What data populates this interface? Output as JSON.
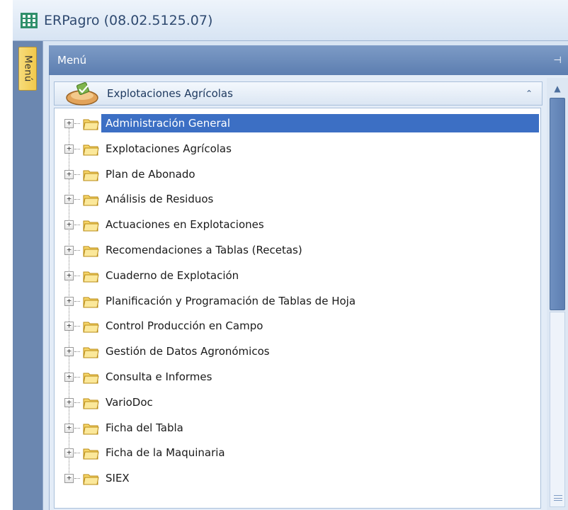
{
  "window": {
    "title": "ERPagro (08.02.5125.07)",
    "icon": "grid-app-icon"
  },
  "sidebar_tab": {
    "label": "Menú"
  },
  "panel": {
    "title": "Menú",
    "pin_icon": "pin-icon"
  },
  "group": {
    "title": "Explotaciones Agrícolas",
    "icon": "tractor-seed-icon",
    "collapse_icon": "double-chevron-up-icon"
  },
  "tree": {
    "selected_index": 0,
    "items": [
      {
        "label": "Administración General"
      },
      {
        "label": "Explotaciones Agrícolas"
      },
      {
        "label": "Plan de Abonado"
      },
      {
        "label": "Análisis de Residuos"
      },
      {
        "label": "Actuaciones en Explotaciones"
      },
      {
        "label": "Recomendaciones a Tablas (Recetas)"
      },
      {
        "label": "Cuaderno de Explotación"
      },
      {
        "label": "Planificación y Programación de Tablas de Hoja"
      },
      {
        "label": "Control Producción en Campo"
      },
      {
        "label": "Gestión de Datos Agronómicos"
      },
      {
        "label": "Consulta e Informes"
      },
      {
        "label": "VarioDoc"
      },
      {
        "label": "Ficha del Tabla"
      },
      {
        "label": "Ficha de la Maquinaria"
      },
      {
        "label": "SIEX"
      }
    ]
  },
  "colors": {
    "selection": "#3c6fc4",
    "panel_header": "#5c7eb0",
    "menu_tab": "#f2c94c"
  }
}
